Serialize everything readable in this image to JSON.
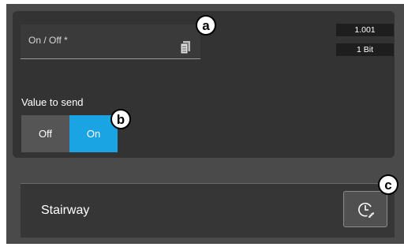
{
  "object": {
    "label": "On / Off *",
    "datapoint_type": "1.001",
    "size": "1 Bit"
  },
  "send": {
    "label": "Value to send",
    "options": [
      "Off",
      "On"
    ],
    "selected": "On"
  },
  "function_row": {
    "label": "Stairway"
  },
  "callouts": {
    "a": "a",
    "b": "b",
    "c": "c"
  },
  "icons": {
    "field": "document-icon",
    "timer": "stairway-timer-icon"
  },
  "colors": {
    "accent": "#1aa4e4",
    "panel": "#333333",
    "background": "#4a4a4a"
  }
}
